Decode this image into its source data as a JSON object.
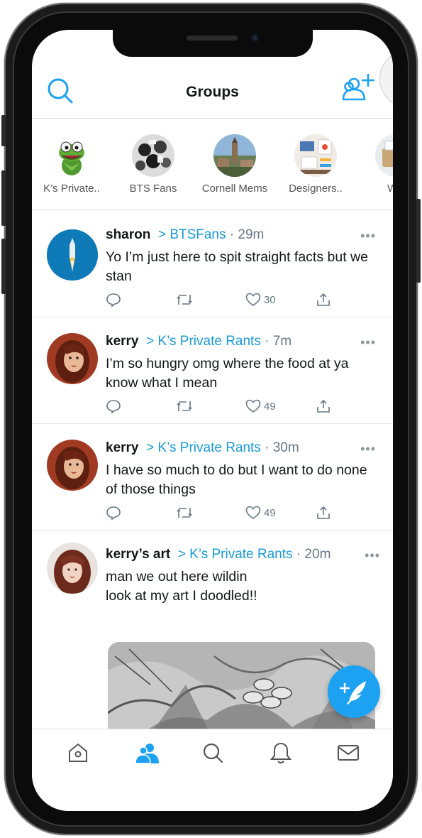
{
  "header": {
    "title": "Groups",
    "left_icon": "search-icon",
    "right_icon": "add-user-icon"
  },
  "groups": [
    {
      "label": "K’s Private..",
      "icon": "kermit-avatar"
    },
    {
      "label": "BTS Fans",
      "icon": "bts-avatar"
    },
    {
      "label": "Cornell Mems",
      "icon": "cornell-avatar"
    },
    {
      "label": "Designers..",
      "icon": "designers-avatar"
    },
    {
      "label": "Whi",
      "icon": "group-avatar"
    }
  ],
  "posts": [
    {
      "name": "sharon",
      "sep": ">",
      "group": "BTSFans",
      "time": "· 29m",
      "text": "Yo I’m just here to spit straight facts but we stan",
      "likes": "30",
      "more": "•••"
    },
    {
      "name": "kerry",
      "sep": ">",
      "group": "K’s Private Rants",
      "time": "· 7m",
      "text": "I’m so hungry omg where the food at ya know what I mean",
      "likes": "49",
      "more": "•••"
    },
    {
      "name": "kerry",
      "sep": ">",
      "group": "K’s Private Rants",
      "time": "· 30m",
      "text": "I have so much to do but I want to do none of those things",
      "likes": "49",
      "more": "•••"
    },
    {
      "name": "kerry’s art",
      "sep": ">",
      "group": "K’s Private Rants",
      "time": "· 20m",
      "text_line1": "man we out here wildin",
      "text_line2": "look at my art I doodled!!",
      "more": "•••"
    }
  ],
  "bottom_nav": [
    "home-icon",
    "groups-icon",
    "search-icon",
    "notifications-icon",
    "messages-icon"
  ],
  "colors": {
    "accent": "#1da1f2",
    "group_link": "#1a9bd7",
    "meta_gray": "#657786"
  }
}
